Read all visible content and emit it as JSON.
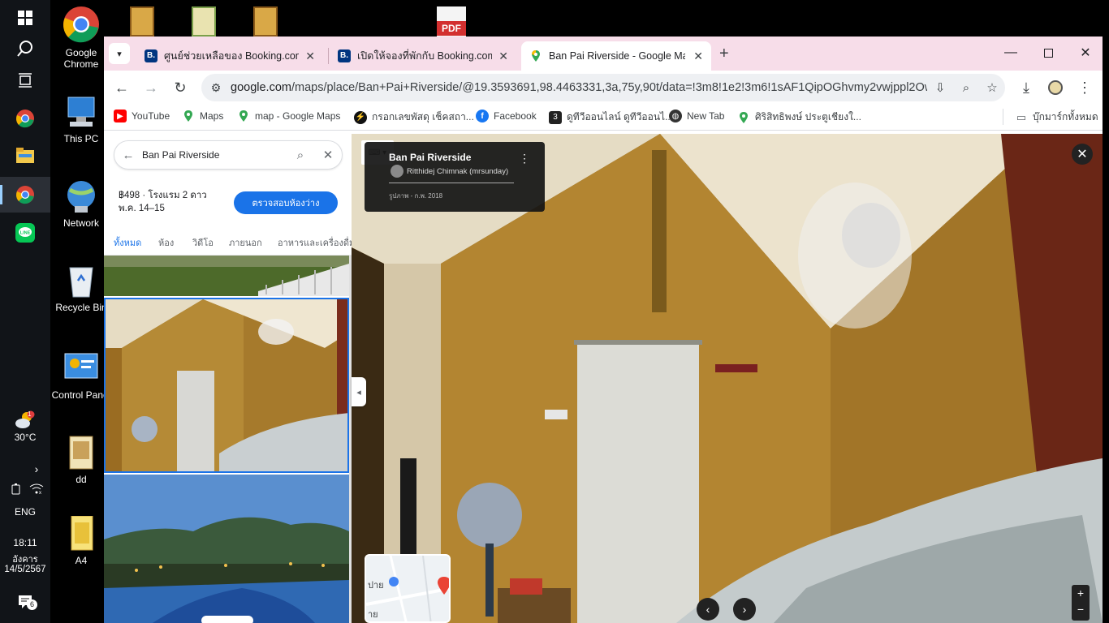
{
  "taskbar": {
    "weather_temp": "30°C",
    "language": "ENG",
    "time": "18:11",
    "day": "อังคาร",
    "date": "14/5/2567",
    "notification_count": "6",
    "weather_badge": "1"
  },
  "desktop": {
    "icons": [
      {
        "label": "Google Chrome"
      },
      {
        "label": "This PC"
      },
      {
        "label": "Network"
      },
      {
        "label": "Recycle Bin"
      },
      {
        "label": "Control Panel"
      },
      {
        "label": "dd"
      },
      {
        "label": "A4"
      }
    ],
    "pdf_label": "PDF"
  },
  "browser": {
    "tabs": [
      {
        "title": "ศูนย์ช่วยเหลือของ Booking.com",
        "favicon": "B."
      },
      {
        "title": "เปิดให้จองที่พักกับ Booking.com",
        "favicon": "B."
      },
      {
        "title": "Ban Pai Riverside - Google Maps",
        "favicon": "maps-pin"
      }
    ],
    "new_tab": "+",
    "url_host": "google.com",
    "url_path": "/maps/place/Ban+Pai+Riverside/@19.3593691,98.4463331,3a,75y,90t/data=!3m8!1e2!3m6!1sAF1QipOGhvmy2vwjppl2OwxL...",
    "bookmarks": [
      {
        "label": "YouTube",
        "color": "#ff0000"
      },
      {
        "label": "Maps",
        "color": "#34a853"
      },
      {
        "label": "map - Google Maps",
        "color": "#34a853"
      },
      {
        "label": "กรอกเลขพัสดุ เช็คสถา...",
        "color": "#111111"
      },
      {
        "label": "Facebook",
        "color": "#1877f2"
      },
      {
        "label": "ดูทีวีออนไลน์ ดูทีวีออนไ...",
        "color": "#222222"
      },
      {
        "label": "New Tab",
        "color": "#333333"
      },
      {
        "label": "ศิริสิทธิพงษ์ ประตูเชียงใ...",
        "color": "#34a853"
      }
    ],
    "all_bookmarks": "บุ๊กมาร์กทั้งหมด"
  },
  "maps": {
    "search_query": "Ban Pai Riverside",
    "price_line": "฿498 · โรงแรม 2 ดาว",
    "dates": "พ.ค. 14–15",
    "check_button": "ตรวจสอบห้องว่าง",
    "filters": [
      "ทั้งหมด",
      "ห้อง",
      "วิดีโอ",
      "ภายนอก",
      "อาหารและเครื่องดื่ม"
    ],
    "photo_place": "Ban Pai Riverside",
    "photo_author": "Ritthidej Chimnak (mrsunday)",
    "photo_date": "รูปภาพ - ก.พ. 2018",
    "accent": "#1a73e8"
  }
}
